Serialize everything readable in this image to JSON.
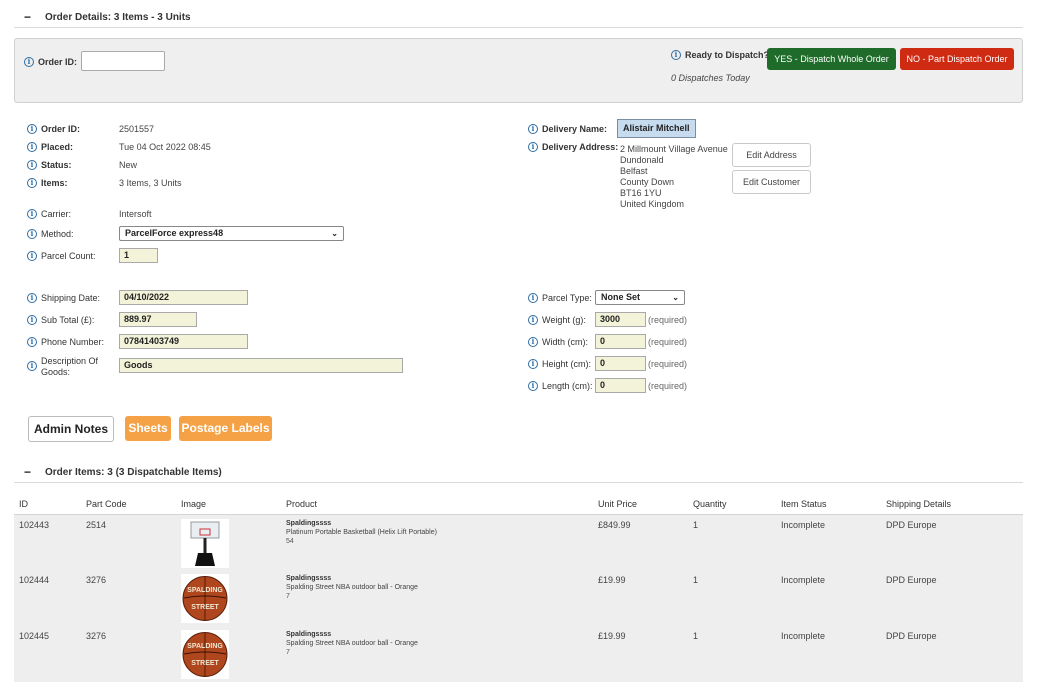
{
  "order_details_section": {
    "toggle": "−",
    "title": "Order Details: 3 Items - 3 Units"
  },
  "dispatch_bar": {
    "order_id_label": "Order ID:",
    "order_id_value": "",
    "ready_label": "Ready to Dispatch?",
    "yes_button": "YES - Dispatch Whole Order",
    "no_button": "NO - Part Dispatch Order",
    "dispatches_today": "0 Dispatches Today",
    "yes_color": "#1e6b2a",
    "no_color": "#cf2a12"
  },
  "info": {
    "order_id": {
      "label": "Order ID:",
      "value": "2501557"
    },
    "placed": {
      "label": "Placed:",
      "value": "Tue 04 Oct 2022 08:45"
    },
    "status": {
      "label": "Status:",
      "value": "New"
    },
    "items": {
      "label": "Items:",
      "value": "3 Items, 3 Units"
    },
    "carrier": {
      "label": "Carrier:",
      "value": "Intersoft"
    },
    "method": {
      "label": "Method:",
      "value": "ParcelForce express48"
    },
    "parcel_count": {
      "label": "Parcel Count:",
      "value": "1"
    }
  },
  "delivery": {
    "name_label": "Delivery Name:",
    "name_value": "Alistair Mitchell",
    "address_label": "Delivery Address:",
    "address_lines": [
      "2 Millmount Village Avenue",
      "Dundonald",
      "Belfast",
      "County Down",
      "BT16 1YU",
      "United Kingdom"
    ],
    "edit_address": "Edit Address",
    "edit_customer": "Edit Customer"
  },
  "shipping": {
    "shipping_date": {
      "label": "Shipping Date:",
      "value": "04/10/2022"
    },
    "sub_total": {
      "label": "Sub Total (£):",
      "value": "889.97"
    },
    "phone": {
      "label": "Phone Number:",
      "value": "07841403749"
    },
    "description": {
      "label_line1": "Description Of",
      "label_line2": "Goods:",
      "value": "Goods"
    }
  },
  "parcel": {
    "type": {
      "label": "Parcel Type:",
      "value": "None Set"
    },
    "weight": {
      "label": "Weight (g):",
      "value": "3000",
      "note": "(required)"
    },
    "width": {
      "label": "Width (cm):",
      "value": "0",
      "note": "(required)"
    },
    "height": {
      "label": "Height (cm):",
      "value": "0",
      "note": "(required)"
    },
    "length": {
      "label": "Length (cm):",
      "value": "0",
      "note": "(required)"
    }
  },
  "actions": {
    "admin_notes": "Admin Notes",
    "sheets": "Sheets",
    "postage_labels": "Postage Labels",
    "orange": "#f5a145"
  },
  "order_items_section": {
    "toggle": "−",
    "title": "Order Items: 3 (3 Dispatchable Items)"
  },
  "table": {
    "headers": [
      "ID",
      "Part Code",
      "Image",
      "Product",
      "Unit Price",
      "Quantity",
      "Item Status",
      "Shipping Details"
    ],
    "rows": [
      {
        "id": "102443",
        "part_code": "2514",
        "image": "basketball-hoop-image",
        "brand": "Spaldingssss",
        "product": "Platinum Portable Basketball (Helix Lift Portable)",
        "size": "54",
        "unit_price": "£849.99",
        "quantity": "1",
        "status": "Incomplete",
        "shipping": "DPD Europe"
      },
      {
        "id": "102444",
        "part_code": "3276",
        "image": "basketball-image",
        "brand": "Spaldingssss",
        "product": "Spalding Street NBA outdoor ball - Orange",
        "size": "7",
        "unit_price": "£19.99",
        "quantity": "1",
        "status": "Incomplete",
        "shipping": "DPD Europe"
      },
      {
        "id": "102445",
        "part_code": "3276",
        "image": "basketball-image",
        "brand": "Spaldingssss",
        "product": "Spalding Street NBA outdoor ball - Orange",
        "size": "7",
        "unit_price": "£19.99",
        "quantity": "1",
        "status": "Incomplete",
        "shipping": "DPD Europe"
      }
    ]
  }
}
